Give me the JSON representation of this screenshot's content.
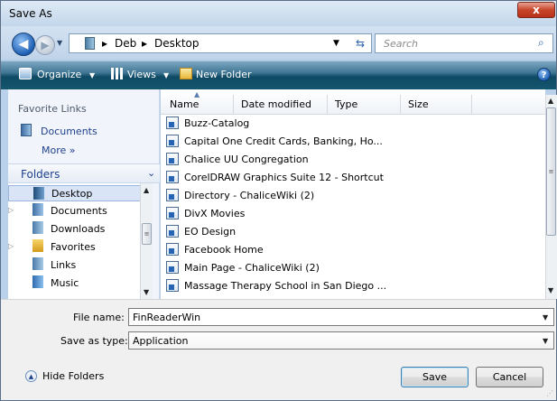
{
  "window": {
    "title": "Save As",
    "close_symbol": "x"
  },
  "nav": {
    "back_symbol": "◀",
    "forward_symbol": "▶",
    "breadcrumb": [
      "Deb",
      "Desktop"
    ],
    "breadcrumb_sep": "▸",
    "search_placeholder": "Search"
  },
  "toolbar": {
    "organize": "Organize",
    "views": "Views",
    "new_folder": "New Folder",
    "help": "?"
  },
  "sidebar": {
    "favorites_header": "Favorite Links",
    "favorites": [
      {
        "label": "Documents",
        "icon": "document-icon"
      }
    ],
    "more_label": "More »",
    "folders_header": "Folders",
    "tree": [
      {
        "label": "Desktop",
        "selected": true,
        "expandable": false
      },
      {
        "label": "Documents",
        "selected": false,
        "expandable": true
      },
      {
        "label": "Downloads",
        "selected": false,
        "expandable": false
      },
      {
        "label": "Favorites",
        "selected": false,
        "expandable": true
      },
      {
        "label": "Links",
        "selected": false,
        "expandable": false
      },
      {
        "label": "Music",
        "selected": false,
        "expandable": false
      }
    ]
  },
  "file_list": {
    "columns": [
      "Name",
      "Date modified",
      "Type",
      "Size"
    ],
    "files": [
      "Buzz-Catalog",
      "Capital One Credit Cards, Banking, Ho...",
      "Chalice UU Congregation",
      "CorelDRAW Graphics Suite 12 - Shortcut",
      "Directory - ChaliceWiki (2)",
      "DivX Movies",
      "EO Design",
      "Facebook  Home",
      "Main Page - ChaliceWiki (2)",
      "Massage Therapy School in San Diego  ..."
    ]
  },
  "form": {
    "file_name_label": "File name:",
    "file_name_value": "FinReaderWin",
    "save_type_label": "Save as type:",
    "save_type_value": "Application"
  },
  "footer": {
    "hide_folders": "Hide Folders",
    "save": "Save",
    "cancel": "Cancel"
  },
  "colors": {
    "toolbar": "#1b5771",
    "accent": "#1e3f8c",
    "selection": "#d9e5f6"
  }
}
